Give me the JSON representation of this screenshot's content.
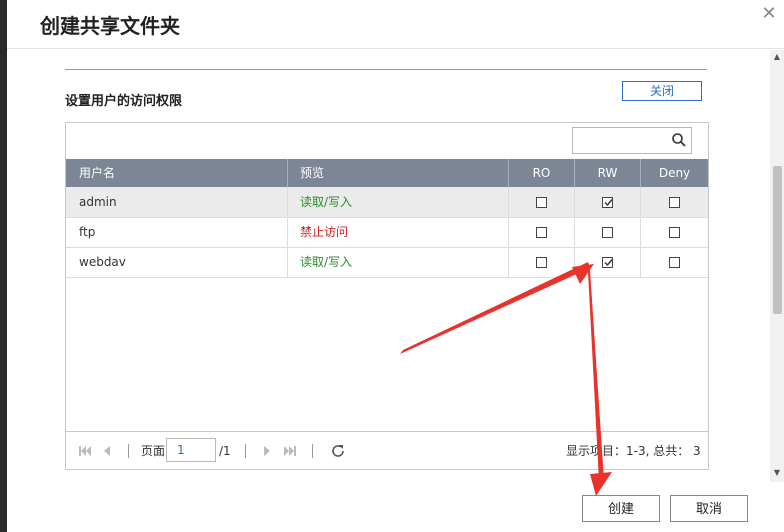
{
  "dialog": {
    "title": "创建共享文件夹",
    "close_icon": "close-icon"
  },
  "section": {
    "title": "设置用户的访问权限",
    "close_label": "关闭"
  },
  "search": {
    "placeholder": ""
  },
  "table": {
    "headers": [
      "用户名",
      "预览",
      "RO",
      "RW",
      "Deny"
    ],
    "rows": [
      {
        "user": "admin",
        "preview": "读取/写入",
        "preview_color": "#2e8a2e",
        "ro": false,
        "rw": true,
        "deny": false
      },
      {
        "user": "ftp",
        "preview": "禁止访问",
        "preview_color": "#d42020",
        "ro": false,
        "rw": false,
        "deny": false
      },
      {
        "user": "webdav",
        "preview": "读取/写入",
        "preview_color": "#2e8a2e",
        "ro": false,
        "rw": true,
        "deny": false
      }
    ]
  },
  "pager": {
    "page_label": "页面",
    "page_value": "1",
    "total_pages": "/1",
    "display_info": "显示项目：1-3, 总共： 3"
  },
  "buttons": {
    "create": "创建",
    "cancel": "取消"
  },
  "colors": {
    "accent": "#2a6fc9",
    "header_bg": "#7d8696",
    "annotation_arrow": "#e8322c"
  }
}
